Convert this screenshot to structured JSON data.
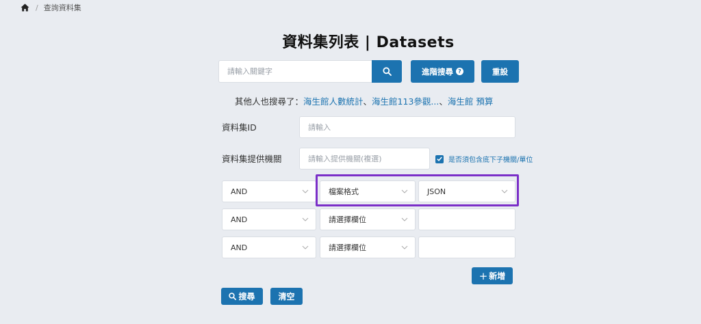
{
  "breadcrumb": {
    "separator": "/",
    "current": "查詢資料集"
  },
  "title": "資料集列表 | Datasets",
  "search": {
    "placeholder": "請輸入關鍵字",
    "advanced_label": "進階搜尋",
    "advanced_help": "?",
    "reset_label": "重設"
  },
  "others": {
    "prefix": "其他人也搜尋了：",
    "links": [
      "海生館人數統計",
      "海生館113參觀...",
      "海生館 預算"
    ],
    "separator": "、"
  },
  "dataset_id": {
    "label": "資料集ID",
    "placeholder": "請輸入"
  },
  "provider": {
    "label": "資料集提供機關",
    "placeholder": "請輸入提供機關(複選)",
    "checkbox_label": "是否須包含底下子機關/單位",
    "checkbox_checked": true
  },
  "conditions": [
    {
      "operator": "AND",
      "field": "檔案格式",
      "value": "JSON"
    },
    {
      "operator": "AND",
      "field": "請選擇欄位",
      "value": ""
    },
    {
      "operator": "AND",
      "field": "請選擇欄位",
      "value": ""
    }
  ],
  "actions": {
    "add_label": "新增",
    "add_prefix": "+",
    "search_label": "搜尋",
    "clear_label": "清空"
  },
  "colors": {
    "accent": "#1c73b0",
    "highlight": "#7b2fc8",
    "background": "#e9ecf1"
  }
}
